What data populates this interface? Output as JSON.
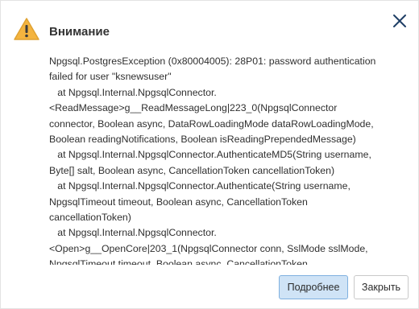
{
  "dialog": {
    "title": "Внимание",
    "icons": {
      "warning": "warning-triangle-icon",
      "close": "close-icon"
    },
    "message_lines": [
      "Npgsql.PostgresException (0x80004005): 28P01: password authentication",
      "failed for user \"ksnewsuser\"",
      "   at Npgsql.Internal.NpgsqlConnector.",
      "<ReadMessage>g__ReadMessageLong|223_0(NpgsqlConnector",
      "connector, Boolean async, DataRowLoadingMode dataRowLoadingMode,",
      "Boolean readingNotifications, Boolean isReadingPrependedMessage)",
      "   at Npgsql.Internal.NpgsqlConnector.AuthenticateMD5(String username,",
      "Byte[] salt, Boolean async, CancellationToken cancellationToken)",
      "   at Npgsql.Internal.NpgsqlConnector.Authenticate(String username,",
      "NpgsqlTimeout timeout, Boolean async, CancellationToken",
      "cancellationToken)",
      "   at Npgsql.Internal.NpgsqlConnector.",
      "<Open>g__OpenCore|203_1(NpgsqlConnector conn, SslMode sslMode,",
      "NpgsqlTimeout timeout, Boolean async, CancellationToken"
    ],
    "buttons": {
      "details": "Подробнее",
      "close": "Закрыть"
    },
    "colors": {
      "warning_fill": "#f4b43f",
      "close_icon": "#1f3f66",
      "primary_button_bg": "#cfe3f6",
      "primary_button_border": "#7fb0df"
    }
  }
}
